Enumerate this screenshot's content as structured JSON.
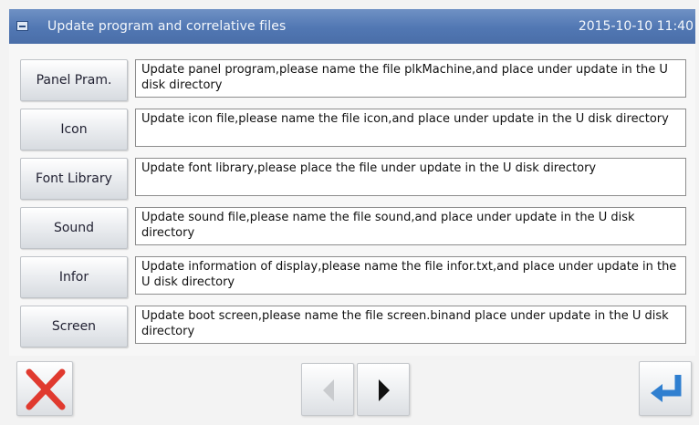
{
  "window": {
    "title": "Update program and correlative files",
    "datetime": "2015-10-10 11:40"
  },
  "rows": [
    {
      "button": "Panel Pram.",
      "description": "Update panel program,please name the file plkMachine,and place under update in the U disk directory"
    },
    {
      "button": "Icon",
      "description": "Update icon file,please name the file icon,and place under update in the U disk directory"
    },
    {
      "button": "Font Library",
      "description": "Update font library,please place the file under update in the U disk directory"
    },
    {
      "button": "Sound",
      "description": "Update sound file,please name the file sound,and place under update in the U disk directory"
    },
    {
      "button": "Infor",
      "description": "Update information of display,please name the file infor.txt,and place under update in the U disk directory"
    },
    {
      "button": "Screen",
      "description": "Update boot screen,please name the file screen.binand place under update in the U disk directory"
    }
  ],
  "footer": {
    "cancel_icon": "close-icon",
    "prev_icon": "arrow-left-icon",
    "next_icon": "arrow-right-icon",
    "enter_icon": "enter-return-icon",
    "prev_enabled": false,
    "next_enabled": true
  },
  "colors": {
    "titlebar": "#5177b3",
    "cancel_red": "#e03a2f",
    "enter_blue": "#2f7fd0"
  }
}
